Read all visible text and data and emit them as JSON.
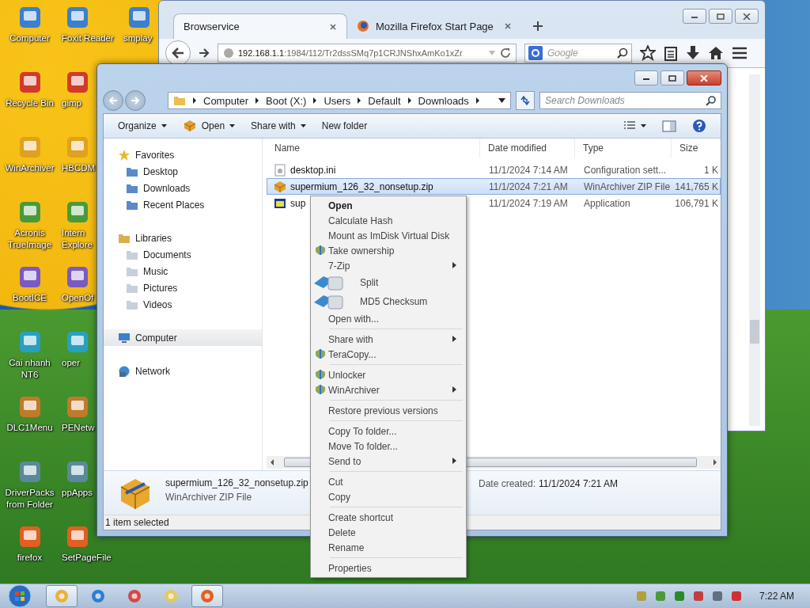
{
  "desktop_icons": [
    {
      "label": "Computer"
    },
    {
      "label": "Recycle Bin"
    },
    {
      "label": "WinArchiver"
    },
    {
      "label": "Acronis\nTrueImage"
    },
    {
      "label": "BootICE"
    },
    {
      "label": "Cai nhanh\nNT6"
    },
    {
      "label": "DLC1Menu"
    },
    {
      "label": "DriverPacks\nfrom Folder"
    },
    {
      "label": "firefox"
    },
    {
      "label": "Foxit Reader"
    },
    {
      "label": "gimp"
    },
    {
      "label": "HBCDM"
    },
    {
      "label": "Intern\nExplore"
    },
    {
      "label": "OpenOf"
    },
    {
      "label": "oper"
    },
    {
      "label": "PENetw"
    },
    {
      "label": "ppApps"
    },
    {
      "label": "SetPageFile"
    },
    {
      "label": "smplay"
    }
  ],
  "browser": {
    "tabs": [
      {
        "label": "Browservice",
        "selected": true
      },
      {
        "label": "Mozilla Firefox Start Page",
        "selected": false
      }
    ],
    "url_host": "192.168.1.1",
    "url_path": ":1984/112/Tr2dssSMq7p1CRJNShxAmKo1xZr",
    "search_placeholder": "Google"
  },
  "explorer": {
    "breadcrumb": [
      "Computer",
      "Boot (X:)",
      "Users",
      "Default",
      "Downloads"
    ],
    "search_placeholder": "Search Downloads",
    "commands": [
      {
        "label": "Organize",
        "kind": "dropdown"
      },
      {
        "label": "Open",
        "kind": "icon-dropdown"
      },
      {
        "label": "Share with",
        "kind": "dropdown"
      },
      {
        "label": "New folder",
        "kind": "plain"
      }
    ],
    "nav": [
      {
        "label": "Favorites",
        "selected": false,
        "children": [
          {
            "label": "Desktop",
            "selected": false
          },
          {
            "label": "Downloads",
            "selected": false
          },
          {
            "label": "Recent Places",
            "selected": false
          }
        ]
      },
      {
        "label": "Libraries",
        "selected": false,
        "children": [
          {
            "label": "Documents",
            "selected": false
          },
          {
            "label": "Music",
            "selected": false
          },
          {
            "label": "Pictures",
            "selected": false
          },
          {
            "label": "Videos",
            "selected": false
          }
        ]
      },
      {
        "label": "Computer",
        "selected": true
      },
      {
        "label": "Network",
        "selected": false
      }
    ],
    "columns": [
      "Name",
      "Date modified",
      "Type",
      "Size"
    ],
    "rows": [
      {
        "name": "desktop.ini",
        "date": "11/1/2024 7:14 AM",
        "type": "Configuration sett...",
        "size": "1 K",
        "kind": "settings",
        "selected": false
      },
      {
        "name": "supermium_126_32_nonsetup.zip",
        "date": "11/1/2024 7:21 AM",
        "type": "WinArchiver ZIP File",
        "size": "141,765 K",
        "kind": "archive",
        "selected": true
      },
      {
        "name": "sup",
        "date": "11/1/2024 7:19 AM",
        "type": "Application",
        "size": "106,791 K",
        "kind": "application",
        "selected": false
      }
    ],
    "details": {
      "name": "supermium_126_32_nonsetup.zip",
      "type": "WinArchiver ZIP File",
      "created_label": "Date created:",
      "created_value": "11/1/2024 7:21 AM"
    },
    "status": "1 item selected"
  },
  "context_menu": [
    {
      "kind": "default",
      "label": "Open"
    },
    {
      "kind": "item",
      "label": "Calculate Hash"
    },
    {
      "kind": "item",
      "label": "Mount as ImDisk Virtual Disk"
    },
    {
      "kind": "icon-item",
      "label": "Take ownership"
    },
    {
      "kind": "submenu",
      "label": "7-Zip"
    },
    {
      "kind": "large",
      "label": "Split"
    },
    {
      "kind": "large",
      "label": "MD5 Checksum"
    },
    {
      "kind": "item",
      "label": "Open with..."
    },
    {
      "kind": "separator"
    },
    {
      "kind": "submenu",
      "label": "Share with"
    },
    {
      "kind": "icon-item",
      "label": "TeraCopy..."
    },
    {
      "kind": "separator"
    },
    {
      "kind": "icon-item",
      "label": "Unlocker"
    },
    {
      "kind": "icon-submenu",
      "label": "WinArchiver"
    },
    {
      "kind": "separator"
    },
    {
      "kind": "item",
      "label": "Restore previous versions"
    },
    {
      "kind": "separator"
    },
    {
      "kind": "item",
      "label": "Copy To folder..."
    },
    {
      "kind": "item",
      "label": "Move To folder..."
    },
    {
      "kind": "submenu",
      "label": "Send to"
    },
    {
      "kind": "separator"
    },
    {
      "kind": "item",
      "label": "Cut"
    },
    {
      "kind": "item",
      "label": "Copy"
    },
    {
      "kind": "separator"
    },
    {
      "kind": "item",
      "label": "Create shortcut"
    },
    {
      "kind": "item",
      "label": "Delete"
    },
    {
      "kind": "item",
      "label": "Rename"
    },
    {
      "kind": "separator"
    },
    {
      "kind": "item",
      "label": "Properties"
    }
  ],
  "taskbar": {
    "buttons": [
      {
        "selected": true
      },
      {
        "selected": false
      },
      {
        "selected": false
      },
      {
        "selected": false
      },
      {
        "selected": true
      }
    ],
    "time": "7:22 AM"
  }
}
